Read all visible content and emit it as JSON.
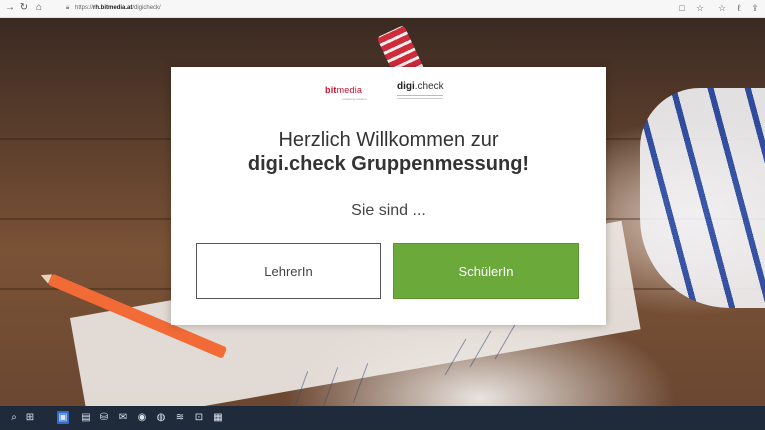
{
  "browser": {
    "back_glyph": "→",
    "refresh_glyph": "↻",
    "home_glyph": "⌂",
    "url_prefix": "https://",
    "url_domain": "rh.bitmedia.at",
    "url_path": "/digicheck/",
    "right_icons": [
      "□",
      "☆",
      "☆",
      "ℓ",
      "⇪"
    ]
  },
  "logos": {
    "bitmedia_bit": "bit",
    "bitmedia_media": "media",
    "bitmedia_tagline": "e-learning solution",
    "digi_bold": "digi",
    "digi_rest": ".check"
  },
  "welcome": {
    "line1": "Herzlich Willkommen zur",
    "line2": "digi.check Gruppenmessung!",
    "question": "Sie sind ..."
  },
  "buttons": {
    "teacher": "LehrerIn",
    "student": "SchülerIn"
  },
  "colors": {
    "student_button": "#6aa93a",
    "brand_red": "#c8102e",
    "taskbar": "#1f2a3a"
  },
  "taskbar": {
    "icons": [
      "⌕",
      "⊞",
      "▣",
      "▤",
      "⛁",
      "✉",
      "◉",
      "◍",
      "≋",
      "⊡",
      "▦"
    ]
  }
}
